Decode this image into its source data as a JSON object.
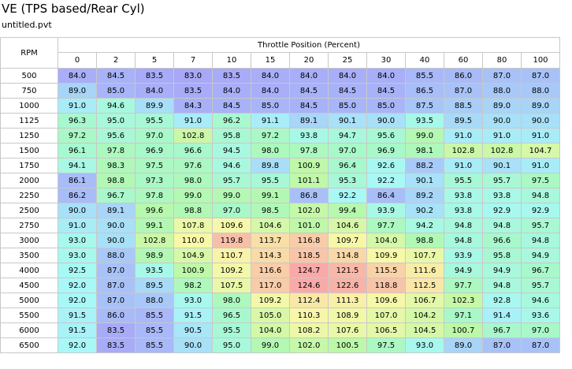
{
  "window": {
    "title": "VE (TPS based/Rear Cyl)",
    "filename": "untitled.pvt"
  },
  "table": {
    "row_axis_label": "RPM",
    "col_axis_label": "Throttle Position (Percent)",
    "columns": [
      "0",
      "2",
      "5",
      "7",
      "10",
      "15",
      "20",
      "25",
      "30",
      "40",
      "60",
      "80",
      "100"
    ],
    "rows": [
      {
        "rpm": "500",
        "values": [
          "84.0",
          "84.5",
          "83.5",
          "83.0",
          "83.5",
          "84.0",
          "84.0",
          "84.0",
          "84.0",
          "85.5",
          "86.0",
          "87.0",
          "87.0"
        ]
      },
      {
        "rpm": "750",
        "values": [
          "89.0",
          "85.0",
          "84.0",
          "83.5",
          "84.0",
          "84.0",
          "84.5",
          "84.5",
          "84.5",
          "86.5",
          "87.0",
          "88.0",
          "88.0"
        ]
      },
      {
        "rpm": "1000",
        "values": [
          "91.0",
          "94.6",
          "89.9",
          "84.3",
          "84.5",
          "85.0",
          "84.5",
          "85.0",
          "85.0",
          "87.5",
          "88.5",
          "89.0",
          "89.0"
        ]
      },
      {
        "rpm": "1125",
        "values": [
          "96.3",
          "95.0",
          "95.5",
          "91.0",
          "96.2",
          "91.1",
          "89.1",
          "90.1",
          "90.0",
          "93.5",
          "89.5",
          "90.0",
          "90.0"
        ]
      },
      {
        "rpm": "1250",
        "values": [
          "97.2",
          "95.6",
          "97.0",
          "102.8",
          "95.8",
          "97.2",
          "93.8",
          "94.7",
          "95.6",
          "99.0",
          "91.0",
          "91.0",
          "91.0"
        ]
      },
      {
        "rpm": "1500",
        "values": [
          "96.1",
          "97.8",
          "96.9",
          "96.6",
          "94.5",
          "98.0",
          "97.8",
          "97.0",
          "96.9",
          "98.1",
          "102.8",
          "102.8",
          "104.7"
        ]
      },
      {
        "rpm": "1750",
        "values": [
          "94.1",
          "98.3",
          "97.5",
          "97.6",
          "94.6",
          "89.8",
          "100.9",
          "96.4",
          "92.6",
          "88.2",
          "91.0",
          "90.1",
          "91.0"
        ]
      },
      {
        "rpm": "2000",
        "values": [
          "86.1",
          "98.8",
          "97.3",
          "98.0",
          "95.7",
          "95.5",
          "101.1",
          "95.3",
          "92.2",
          "90.1",
          "95.5",
          "95.7",
          "97.5"
        ]
      },
      {
        "rpm": "2250",
        "values": [
          "86.2",
          "96.7",
          "97.8",
          "99.0",
          "99.0",
          "99.1",
          "86.8",
          "92.2",
          "86.4",
          "89.2",
          "93.8",
          "93.8",
          "94.8"
        ]
      },
      {
        "rpm": "2500",
        "values": [
          "90.0",
          "89.1",
          "99.6",
          "98.8",
          "97.0",
          "98.5",
          "102.0",
          "99.4",
          "93.9",
          "90.2",
          "93.8",
          "92.9",
          "92.9"
        ]
      },
      {
        "rpm": "2750",
        "values": [
          "91.0",
          "90.0",
          "99.1",
          "107.8",
          "109.6",
          "104.6",
          "101.0",
          "104.6",
          "97.7",
          "94.2",
          "94.8",
          "94.8",
          "95.7"
        ]
      },
      {
        "rpm": "3000",
        "values": [
          "93.0",
          "90.0",
          "102.8",
          "110.0",
          "119.8",
          "113.7",
          "116.8",
          "109.7",
          "104.0",
          "98.8",
          "94.8",
          "96.6",
          "94.8"
        ]
      },
      {
        "rpm": "3500",
        "values": [
          "93.0",
          "88.0",
          "98.9",
          "104.9",
          "110.7",
          "114.3",
          "118.5",
          "114.8",
          "109.9",
          "107.7",
          "93.9",
          "95.8",
          "94.9"
        ]
      },
      {
        "rpm": "4000",
        "values": [
          "92.5",
          "87.0",
          "93.5",
          "100.9",
          "109.2",
          "116.6",
          "124.7",
          "121.5",
          "115.5",
          "111.6",
          "94.9",
          "94.9",
          "96.7"
        ]
      },
      {
        "rpm": "4500",
        "values": [
          "92.0",
          "87.0",
          "89.5",
          "98.2",
          "107.5",
          "117.0",
          "124.6",
          "122.6",
          "118.8",
          "112.5",
          "97.7",
          "94.8",
          "95.7"
        ]
      },
      {
        "rpm": "5000",
        "values": [
          "92.0",
          "87.0",
          "88.0",
          "93.0",
          "98.0",
          "109.2",
          "112.4",
          "111.3",
          "109.6",
          "106.7",
          "102.3",
          "92.8",
          "94.6"
        ]
      },
      {
        "rpm": "5500",
        "values": [
          "91.5",
          "86.0",
          "85.5",
          "91.5",
          "96.5",
          "105.0",
          "110.3",
          "108.9",
          "107.0",
          "104.2",
          "97.1",
          "91.4",
          "93.6"
        ]
      },
      {
        "rpm": "6000",
        "values": [
          "91.5",
          "83.5",
          "85.5",
          "90.5",
          "95.5",
          "104.0",
          "108.2",
          "107.6",
          "106.5",
          "104.5",
          "100.7",
          "96.7",
          "97.0"
        ]
      },
      {
        "rpm": "6500",
        "values": [
          "92.0",
          "83.5",
          "85.5",
          "90.0",
          "95.0",
          "99.0",
          "102.0",
          "100.5",
          "97.5",
          "93.0",
          "89.0",
          "87.0",
          "87.0"
        ]
      }
    ]
  },
  "color_scale": {
    "stops": [
      {
        "v": 83,
        "color": "#a8a8f8"
      },
      {
        "v": 88,
        "color": "#a8c8f8"
      },
      {
        "v": 92,
        "color": "#a8f8f8"
      },
      {
        "v": 97,
        "color": "#a8f8c8"
      },
      {
        "v": 100,
        "color": "#b8f8a8"
      },
      {
        "v": 105,
        "color": "#d8f8a8"
      },
      {
        "v": 110,
        "color": "#f8f8a8"
      },
      {
        "v": 116,
        "color": "#f8d0a8"
      },
      {
        "v": 125,
        "color": "#f8a8a8"
      }
    ]
  }
}
